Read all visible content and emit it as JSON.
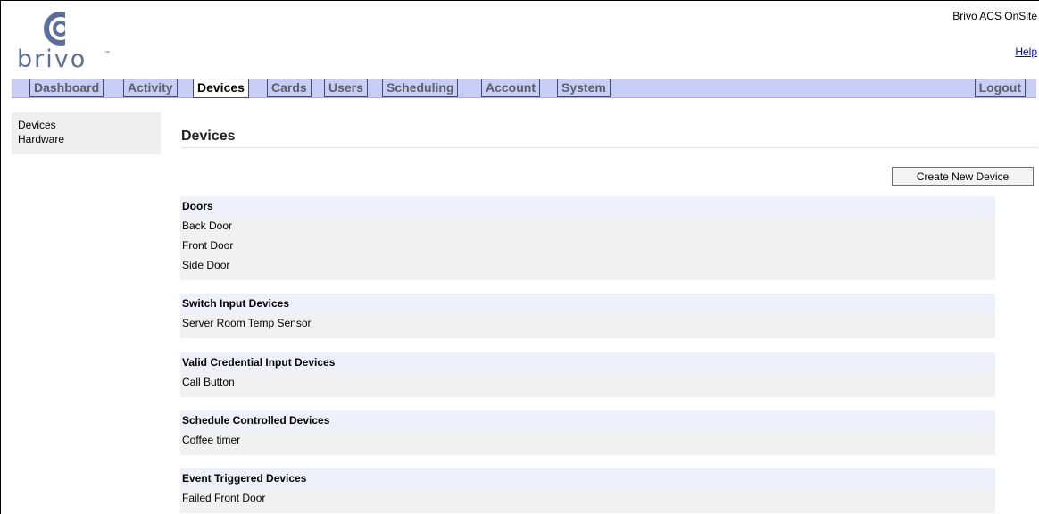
{
  "brand": {
    "logo_text": "brivo",
    "tm": "™"
  },
  "header": {
    "app_title": "Brivo ACS OnSite",
    "help": "Help"
  },
  "nav": {
    "tabs": [
      "Dashboard",
      "Activity",
      "Devices",
      "Cards",
      "Users",
      "Scheduling",
      "Account",
      "System"
    ],
    "active": "Devices",
    "logout": "Logout"
  },
  "sidebar": {
    "items": [
      "Devices",
      "Hardware"
    ]
  },
  "main": {
    "title": "Devices",
    "create_button": "Create New Device",
    "sections": [
      {
        "title": "Doors",
        "items": [
          "Back Door",
          "Front Door",
          "Side Door"
        ]
      },
      {
        "title": "Switch Input Devices",
        "items": [
          "Server Room Temp Sensor"
        ]
      },
      {
        "title": "Valid Credential Input Devices",
        "items": [
          "Call Button"
        ]
      },
      {
        "title": "Schedule Controlled Devices",
        "items": [
          "Coffee timer"
        ]
      },
      {
        "title": "Event Triggered Devices",
        "items": [
          "Failed Front Door"
        ]
      }
    ]
  },
  "colors": {
    "nav_bg": "#c8cdf5",
    "section_head_bg": "#eef0fb",
    "section_body_bg": "#f1f1f1",
    "logo": "#5b6f9a"
  }
}
